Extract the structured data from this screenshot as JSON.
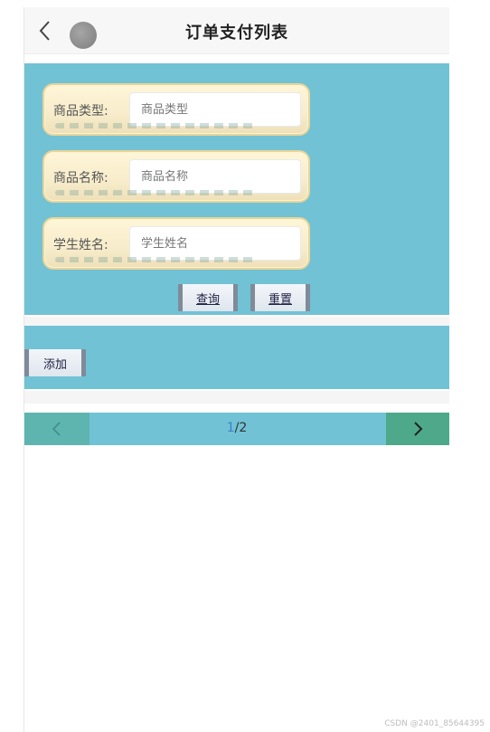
{
  "header": {
    "title": "订单支付列表",
    "back_icon": "chevron-left-icon",
    "avatar_icon": "avatar-icon"
  },
  "search": {
    "fields": [
      {
        "label": "商品类型:",
        "placeholder": "商品类型"
      },
      {
        "label": "商品名称:",
        "placeholder": "商品名称"
      },
      {
        "label": "学生姓名:",
        "placeholder": "学生姓名"
      }
    ],
    "query_button": "查询",
    "reset_button": "重置"
  },
  "actions": {
    "add_button": "添加"
  },
  "pagination": {
    "current": "1",
    "total": "/2"
  },
  "watermark": "CSDN @2401_85644395",
  "colors": {
    "panel": "#71c2d5",
    "prev": "#5eb5b0",
    "next": "#4ea98a"
  }
}
